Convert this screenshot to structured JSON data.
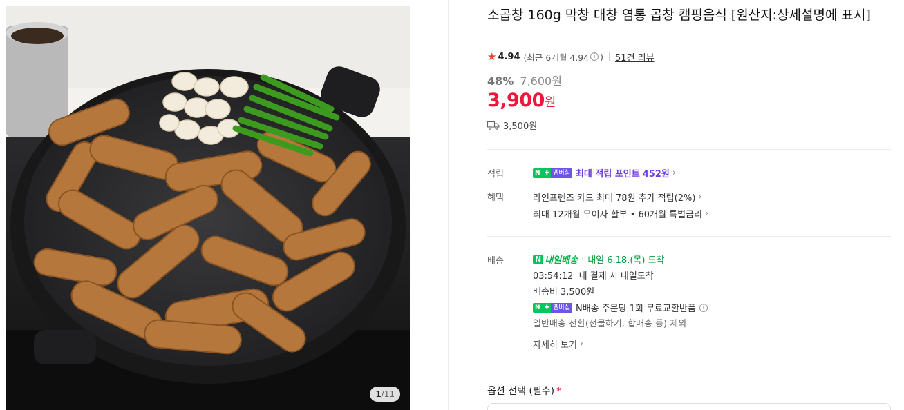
{
  "image": {
    "counter_current": "1",
    "counter_separator": "/",
    "counter_total": "11",
    "alt_icons": [
      "grill-pan-icon",
      "garlic-icon",
      "green-onion-icon",
      "sauce-cup-icon"
    ]
  },
  "product": {
    "title": "소곱창 160g 막창 대창 염통 곱창 캠핑음식 [원산지:상세설명에 표시]"
  },
  "rating": {
    "score": "4.94",
    "recent_text": "(최근 6개월 4.94",
    "recent_close": ")",
    "info_glyph": "i",
    "review_count": "51건 리뷰"
  },
  "price": {
    "discount": "48%",
    "original": "7,600원",
    "sale": "3,900",
    "unit": "원",
    "shipping": "3,500원"
  },
  "benefits": {
    "points_label": "적립",
    "badge_n": "N",
    "badge_plus": "✚",
    "badge_member": "멤버십",
    "points_text": "최대 적립 포인트",
    "points_amount": "452원",
    "perks_label": "혜택",
    "perk_card": "라인프렌즈 카드 최대 78원 추가 적립(2%)",
    "perk_installment": "최대 12개월 무이자 할부 • 60개월 특별금리"
  },
  "delivery": {
    "label": "배송",
    "logo_n": "N",
    "logo_text": "내일배송",
    "dot": "·",
    "arrival": "내일 6.18.(목) 도착",
    "countdown": "03:54:12  내 결제 시 내일도착",
    "fee": "배송비 3,500원",
    "exchange": "N배송 주문당 1회 무료교환반품",
    "excluded": "일반배송 전환(선물하기, 합배송 등) 제외",
    "detail_link": "자세히 보기"
  },
  "option": {
    "label": "옵션 선택 (필수)",
    "required_mark": "*"
  },
  "colors": {
    "sale_red": "#f0153a",
    "star": "#f0412e",
    "naver_green": "#03c75a",
    "member_purple": "#6e56e5",
    "point_purple": "#6e3fe0"
  }
}
